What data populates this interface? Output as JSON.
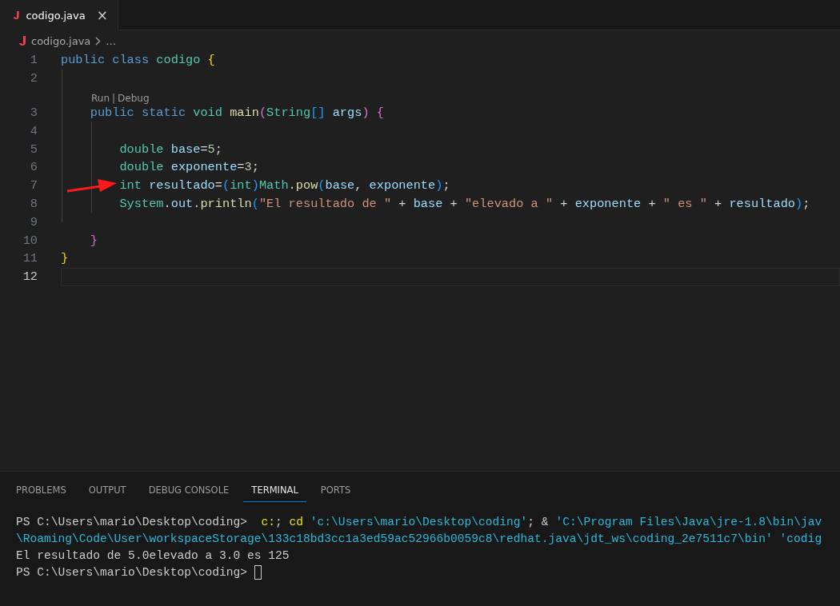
{
  "tabs": [
    {
      "label": "codigo.java",
      "selected": true,
      "close": "×"
    }
  ],
  "breadcrumb": {
    "file": "codigo.java",
    "rest": "…"
  },
  "editor": {
    "lines": [
      {
        "kind": "code",
        "number": "1",
        "selected": false,
        "tokens": [
          {
            "text": "public ",
            "kind": "keyword"
          },
          {
            "text": "class ",
            "kind": "keyword"
          },
          {
            "text": "codigo ",
            "kind": "type"
          },
          {
            "text": "{",
            "kind": "bracket1"
          }
        ]
      },
      {
        "kind": "code",
        "number": "2",
        "selected": false
      },
      {
        "kind": "codelens",
        "items": [
          "Run",
          "Debug"
        ],
        "separator": "|"
      },
      {
        "kind": "code",
        "number": "3",
        "selected": false,
        "tokens": [
          {
            "text": "    public ",
            "kind": "keyword"
          },
          {
            "text": "static ",
            "kind": "keyword"
          },
          {
            "text": "void ",
            "kind": "type"
          },
          {
            "text": "main",
            "kind": "function"
          },
          {
            "text": "(",
            "kind": "bracket2"
          },
          {
            "text": "String",
            "kind": "type"
          },
          {
            "text": "[]",
            "kind": "bracket3"
          },
          {
            "text": " args",
            "kind": "variable"
          },
          {
            "text": ") {",
            "kind": "bracket2"
          }
        ]
      },
      {
        "kind": "code",
        "number": "4",
        "selected": false
      },
      {
        "kind": "code",
        "number": "5",
        "selected": false,
        "tokens": [
          {
            "text": "        double ",
            "kind": "type"
          },
          {
            "text": "base",
            "kind": "variable"
          },
          {
            "text": "=",
            "kind": "plain"
          },
          {
            "text": "5",
            "kind": "number"
          },
          {
            "text": ";",
            "kind": "plain"
          }
        ]
      },
      {
        "kind": "code",
        "number": "6",
        "selected": false,
        "tokens": [
          {
            "text": "        double ",
            "kind": "type"
          },
          {
            "text": "exponente",
            "kind": "variable"
          },
          {
            "text": "=",
            "kind": "plain"
          },
          {
            "text": "3",
            "kind": "number"
          },
          {
            "text": ";",
            "kind": "plain"
          }
        ]
      },
      {
        "kind": "code",
        "number": "7",
        "selected": false,
        "tokens": [
          {
            "text": "        int ",
            "kind": "type"
          },
          {
            "text": "resultado",
            "kind": "variable"
          },
          {
            "text": "=",
            "kind": "plain"
          },
          {
            "text": "(",
            "kind": "bracket3"
          },
          {
            "text": "int",
            "kind": "type"
          },
          {
            "text": ")",
            "kind": "bracket3"
          },
          {
            "text": "Math",
            "kind": "type"
          },
          {
            "text": ".",
            "kind": "plain"
          },
          {
            "text": "pow",
            "kind": "function"
          },
          {
            "text": "(",
            "kind": "bracket3"
          },
          {
            "text": "base",
            "kind": "variable"
          },
          {
            "text": ", ",
            "kind": "plain"
          },
          {
            "text": "exponente",
            "kind": "variable"
          },
          {
            "text": ")",
            "kind": "bracket3"
          },
          {
            "text": ";",
            "kind": "plain"
          }
        ]
      },
      {
        "kind": "code",
        "number": "8",
        "selected": false,
        "tokens": [
          {
            "text": "        System",
            "kind": "type"
          },
          {
            "text": ".",
            "kind": "plain"
          },
          {
            "text": "out",
            "kind": "variable"
          },
          {
            "text": ".",
            "kind": "plain"
          },
          {
            "text": "println",
            "kind": "function"
          },
          {
            "text": "(",
            "kind": "bracket3"
          },
          {
            "text": "\"El resultado de \"",
            "kind": "string"
          },
          {
            "text": " + ",
            "kind": "plain"
          },
          {
            "text": "base",
            "kind": "variable"
          },
          {
            "text": " + ",
            "kind": "plain"
          },
          {
            "text": "\"elevado a \"",
            "kind": "string"
          },
          {
            "text": " + ",
            "kind": "plain"
          },
          {
            "text": "exponente",
            "kind": "variable"
          },
          {
            "text": " + ",
            "kind": "plain"
          },
          {
            "text": "\" es \"",
            "kind": "string"
          },
          {
            "text": " + ",
            "kind": "plain"
          },
          {
            "text": "resultado",
            "kind": "variable"
          },
          {
            "text": ")",
            "kind": "bracket3"
          },
          {
            "text": ";",
            "kind": "plain"
          }
        ]
      },
      {
        "kind": "code",
        "number": "9",
        "selected": false
      },
      {
        "kind": "code",
        "number": "10",
        "selected": false,
        "tokens": [
          {
            "text": "    }",
            "kind": "bracket2"
          }
        ]
      },
      {
        "kind": "code",
        "number": "11",
        "selected": false,
        "tokens": [
          {
            "text": "}",
            "kind": "bracket1"
          }
        ]
      },
      {
        "kind": "code",
        "number": "12",
        "selected": true
      }
    ]
  },
  "panel": {
    "tabs": [
      {
        "label": "PROBLEMS",
        "selected": false
      },
      {
        "label": "OUTPUT",
        "selected": false
      },
      {
        "label": "DEBUG CONSOLE",
        "selected": false
      },
      {
        "label": "TERMINAL",
        "selected": true
      },
      {
        "label": "PORTS",
        "selected": false
      }
    ],
    "terminal": [
      {
        "tokens": [
          {
            "text": "PS C:\\Users\\mario\\Desktop\\coding>  ",
            "kind": "plain"
          },
          {
            "text": "c:",
            "kind": "command"
          },
          {
            "text": "; ",
            "kind": "plain"
          },
          {
            "text": "cd ",
            "kind": "command"
          },
          {
            "text": "'c:\\Users\\mario\\Desktop\\coding'",
            "kind": "string"
          },
          {
            "text": "; & ",
            "kind": "plain"
          },
          {
            "text": "'C:\\Program Files\\Java\\jre-1.8\\bin\\jav",
            "kind": "string"
          }
        ]
      },
      {
        "tokens": [
          {
            "text": "\\Roaming\\Code\\User\\workspaceStorage\\133c18bd3cc1a3ed59ac52966b0059c8\\redhat.java\\jdt_ws\\coding_2e7511c7\\bin' 'codig",
            "kind": "string"
          }
        ]
      },
      {
        "tokens": [
          {
            "text": "El resultado de 5.0elevado a 3.0 es 125",
            "kind": "plain"
          }
        ]
      },
      {
        "tokens": [
          {
            "text": "PS C:\\Users\\mario\\Desktop\\coding> ",
            "kind": "plain"
          }
        ],
        "cursor": true
      }
    ]
  }
}
